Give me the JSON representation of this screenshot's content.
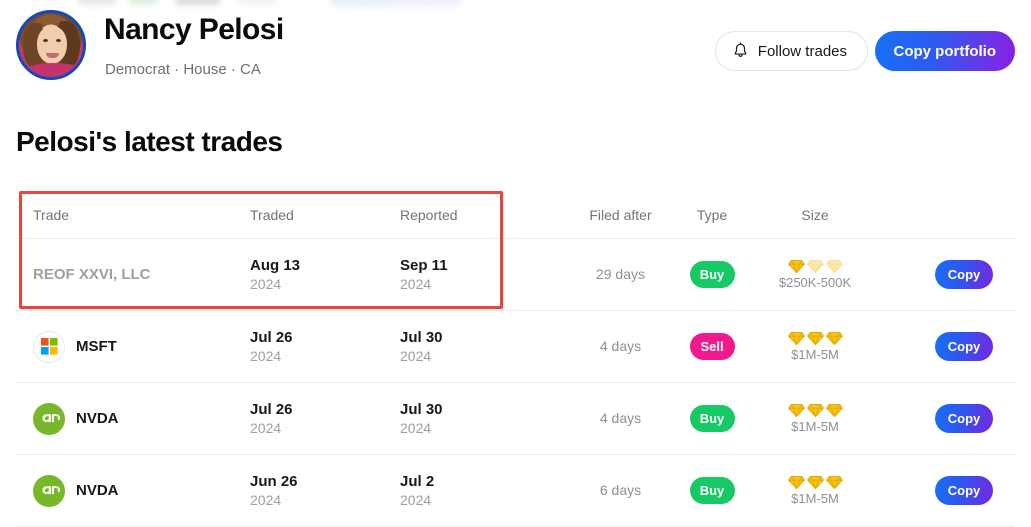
{
  "profile": {
    "name": "Nancy Pelosi",
    "meta": "Democrat · House · CA",
    "avatar_icon": "politician-avatar",
    "follow_button": "Follow trades",
    "follow_icon": "bell-icon",
    "copy_portfolio_button": "Copy portfolio"
  },
  "section": {
    "title": "Pelosi's latest trades"
  },
  "table": {
    "columns": {
      "trade": "Trade",
      "traded": "Traded",
      "reported": "Reported",
      "filed_after": "Filed after",
      "type": "Type",
      "size": "Size",
      "action": ""
    },
    "rows": [
      {
        "symbol": "REOF XXVI, LLC",
        "logo": "none",
        "traded_date": "Aug 13",
        "traded_year": "2024",
        "reported_date": "Sep 11",
        "reported_year": "2024",
        "filed_after": "29 days",
        "type": "Buy",
        "gems_filled": 1,
        "gems_total": 3,
        "size": "$250K-500K",
        "action": "Copy"
      },
      {
        "symbol": "MSFT",
        "logo": "microsoft-logo",
        "traded_date": "Jul 26",
        "traded_year": "2024",
        "reported_date": "Jul 30",
        "reported_year": "2024",
        "filed_after": "4 days",
        "type": "Sell",
        "gems_filled": 3,
        "gems_total": 3,
        "size": "$1M-5M",
        "action": "Copy"
      },
      {
        "symbol": "NVDA",
        "logo": "nvidia-logo",
        "traded_date": "Jul 26",
        "traded_year": "2024",
        "reported_date": "Jul 30",
        "reported_year": "2024",
        "filed_after": "4 days",
        "type": "Buy",
        "gems_filled": 3,
        "gems_total": 3,
        "size": "$1M-5M",
        "action": "Copy"
      },
      {
        "symbol": "NVDA",
        "logo": "nvidia-logo",
        "traded_date": "Jun 26",
        "traded_year": "2024",
        "reported_date": "Jul 2",
        "reported_year": "2024",
        "filed_after": "6 days",
        "type": "Buy",
        "gems_filled": 3,
        "gems_total": 3,
        "size": "$1M-5M",
        "action": "Copy"
      }
    ]
  },
  "annotation": {
    "shape": "rectangle-highlight",
    "color": "#e8453c"
  },
  "colors": {
    "buy": "#17c964",
    "sell": "#f01a8c",
    "gem_filled": "#f5c518",
    "gem_empty": "#fbeab0",
    "gradient_start": "#1671f5",
    "gradient_end": "#8b1fe0",
    "annotation": "#e8453c"
  }
}
